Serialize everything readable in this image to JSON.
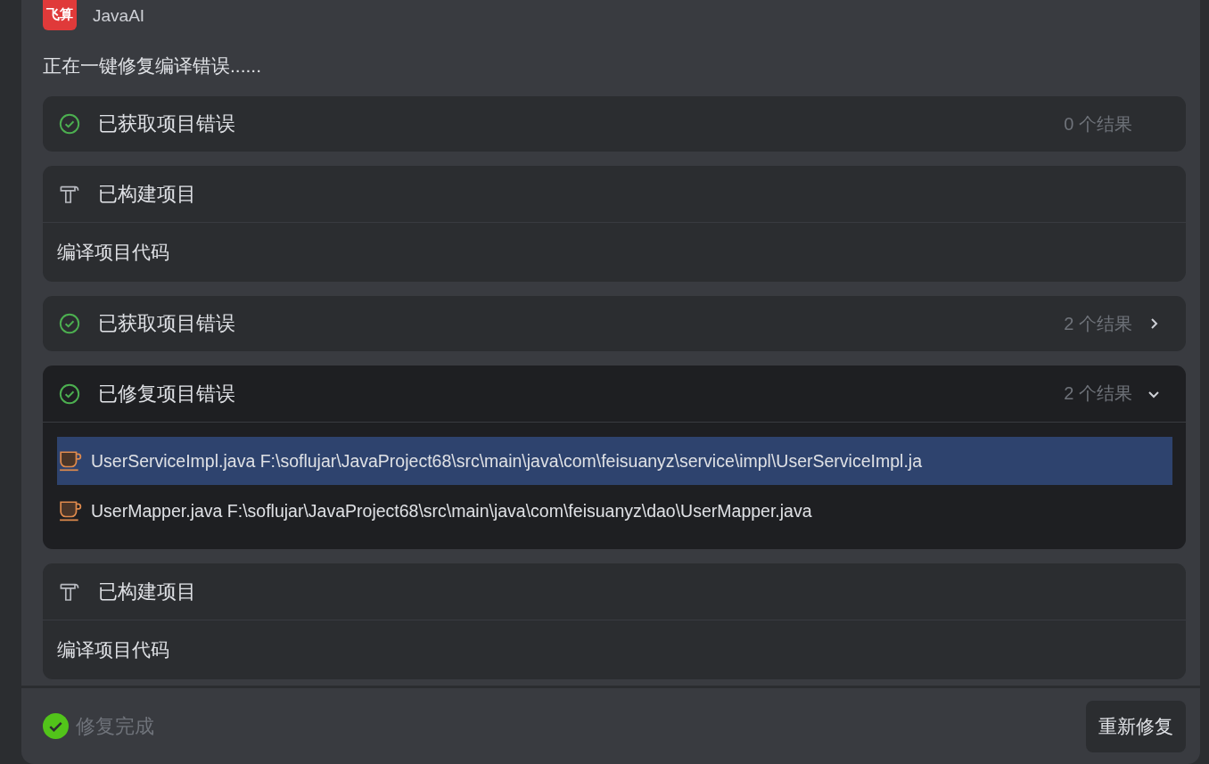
{
  "assistant": {
    "logo": "飞算",
    "name": "JavaAI"
  },
  "message": "正在一键修复编译错误......",
  "steps": [
    {
      "kind": "result",
      "title": "已获取项目错误",
      "count": "0 个结果"
    },
    {
      "kind": "build",
      "title": "已构建项目",
      "detail": "编译项目代码"
    },
    {
      "kind": "result",
      "title": "已获取项目错误",
      "count": "2 个结果",
      "expanded": false
    },
    {
      "kind": "result",
      "title": "已修复项目错误",
      "count": "2 个结果",
      "expanded": true,
      "files": [
        {
          "text": "UserServiceImpl.java F:\\soflujar\\JavaProject68\\src\\main\\java\\com\\feisuanyz\\service\\impl\\UserServiceImpl.ja",
          "selected": true
        },
        {
          "text": "UserMapper.java F:\\soflujar\\JavaProject68\\src\\main\\java\\com\\feisuanyz\\dao\\UserMapper.java",
          "selected": false
        }
      ]
    },
    {
      "kind": "build",
      "title": "已构建项目",
      "detail": "编译项目代码"
    }
  ],
  "footer": {
    "status": "修复完成",
    "done": true,
    "button": "重新修复"
  }
}
